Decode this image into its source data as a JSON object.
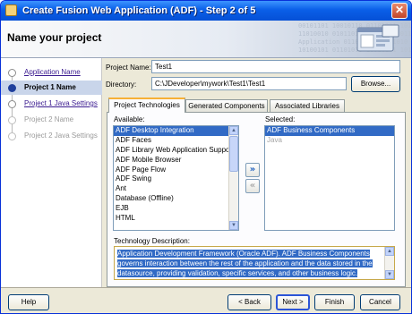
{
  "window": {
    "title": "Create Fusion Web Application (ADF) - Step 2 of 5",
    "close_glyph": "✕"
  },
  "header": {
    "title": "Name your project",
    "deco_text": "00101101 10010110 01101001 10110100\n11010010 01011010 10010110 01101011\nApplication 01101001 10011010 01011\n10100101 01101010 10010101 10100110"
  },
  "nav": {
    "items": [
      {
        "label": "Application Name",
        "state": "link"
      },
      {
        "label": "Project 1 Name",
        "state": "active"
      },
      {
        "label": "Project 1 Java Settings",
        "state": "link"
      },
      {
        "label": "Project 2 Name",
        "state": "disabled"
      },
      {
        "label": "Project 2 Java Settings",
        "state": "disabled"
      }
    ]
  },
  "form": {
    "project_name_label": "Project Name:",
    "project_name_value": "Test1",
    "directory_label": "Directory:",
    "directory_value": "C:\\JDeveloper\\mywork\\Test1\\Test1",
    "browse_label": "Browse..."
  },
  "tabs": [
    "Project Technologies",
    "Generated Components",
    "Associated Libraries"
  ],
  "available": {
    "label": "Available:",
    "items": [
      {
        "label": "ADF Desktop Integration",
        "selected": true
      },
      {
        "label": "ADF Faces"
      },
      {
        "label": "ADF Library Web Application Support"
      },
      {
        "label": "ADF Mobile Browser"
      },
      {
        "label": "ADF Page Flow"
      },
      {
        "label": "ADF Swing"
      },
      {
        "label": "Ant"
      },
      {
        "label": "Database (Offline)"
      },
      {
        "label": "EJB"
      },
      {
        "label": "HTML"
      }
    ]
  },
  "selected": {
    "label": "Selected:",
    "items": [
      {
        "label": "ADF Business Components",
        "selected": true
      },
      {
        "label": "Java",
        "disabled": true
      }
    ]
  },
  "move": {
    "add_glyph": "»",
    "remove_glyph": "«"
  },
  "description": {
    "label": "Technology Description:",
    "text": "Application Development Framework (Oracle ADF).  ADF Business Components governs interaction between the rest of the application and the data stored in the datasource, providing validation, specific services, and other business logic."
  },
  "footer": {
    "help": "Help",
    "back": "< Back",
    "next": "Next >",
    "finish": "Finish",
    "cancel": "Cancel"
  }
}
